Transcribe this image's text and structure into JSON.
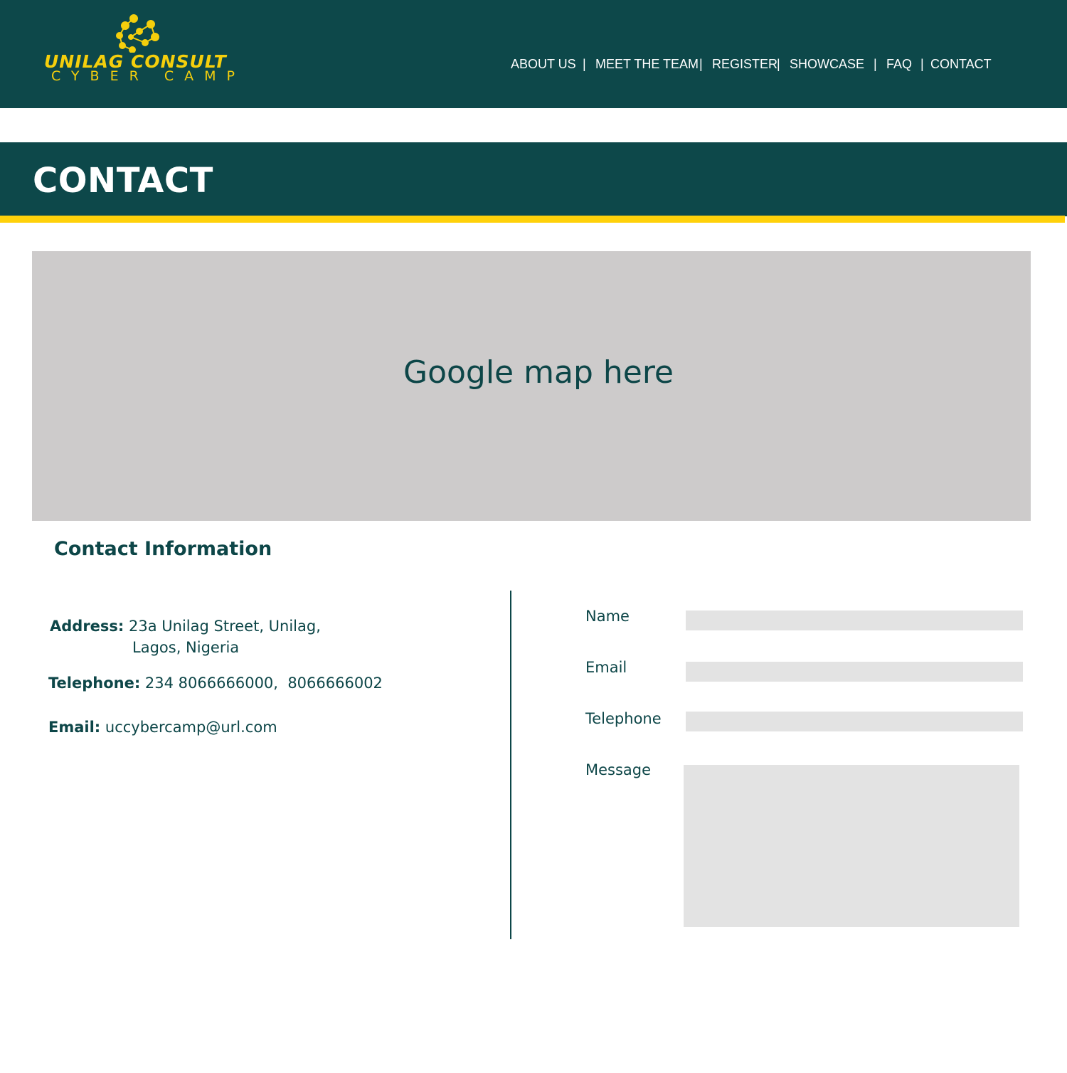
{
  "brand": {
    "line1": "UNILAG CONSULT",
    "line2": "CYBER CAMP",
    "logo_icon": "molecule-icon",
    "color": "#f5cf0c"
  },
  "nav": {
    "items": [
      "ABOUT US",
      "MEET THE TEAM",
      "REGISTER",
      "SHOWCASE",
      "FAQ",
      "CONTACT"
    ],
    "separator": "|"
  },
  "banner": {
    "title": "CONTACT"
  },
  "map": {
    "placeholder": "Google map here"
  },
  "contact_info": {
    "title": "Contact Information",
    "address_label": "Address:",
    "address_line1": "23a Unilag Street, Unilag,",
    "address_line2": "Lagos, Nigeria",
    "telephone_label": "Telephone:",
    "telephone_value": "234 8066666000,  8066666002",
    "email_label": "Email:",
    "email_value": "uccybercamp@url.com"
  },
  "form": {
    "name_label": "Name",
    "email_label": "Email",
    "telephone_label": "Telephone",
    "message_label": "Message",
    "name_value": "",
    "email_value": "",
    "telephone_value": "",
    "message_value": ""
  },
  "colors": {
    "primary": "#0d484a",
    "accent": "#ffd10a",
    "map_bg": "#cdcbcb",
    "field_bg": "#e3e3e3"
  }
}
